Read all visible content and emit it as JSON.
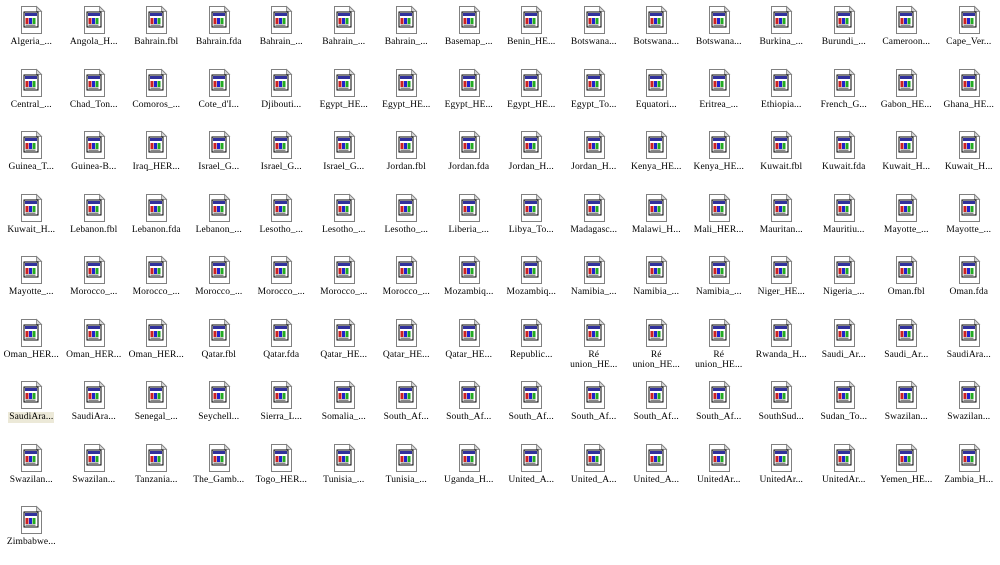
{
  "window": {
    "view_mode": "icons",
    "background_color": "#ffffff",
    "selection_highlight_color": "#ece9d8",
    "label_text_color": "#000000",
    "columns": 16,
    "rows": 9,
    "total_items": 129
  },
  "icon": {
    "semantic_name": "html-document-icon",
    "page_color": "#ffffff",
    "border_color": "#808080",
    "titlebar_color": "#31319c",
    "fold_color": "#c0c0c0",
    "content_colors": [
      "#cc2222",
      "#2222cc",
      "#22aa22",
      "#dd8800"
    ]
  },
  "files": [
    {
      "label": "Algeria_...",
      "selected": false
    },
    {
      "label": "Angola_H...",
      "selected": false
    },
    {
      "label": "Bahrain.fbl",
      "selected": false
    },
    {
      "label": "Bahrain.fda",
      "selected": false
    },
    {
      "label": "Bahrain_...",
      "selected": false
    },
    {
      "label": "Bahrain_...",
      "selected": false
    },
    {
      "label": "Bahrain_...",
      "selected": false
    },
    {
      "label": "Basemap_...",
      "selected": false
    },
    {
      "label": "Benin_HE...",
      "selected": false
    },
    {
      "label": "Botswana...",
      "selected": false
    },
    {
      "label": "Botswana...",
      "selected": false
    },
    {
      "label": "Botswana...",
      "selected": false
    },
    {
      "label": "Burkina_...",
      "selected": false
    },
    {
      "label": "Burundi_...",
      "selected": false
    },
    {
      "label": "Cameroon...",
      "selected": false
    },
    {
      "label": "Cape_Ver...",
      "selected": false
    },
    {
      "label": "Central_...",
      "selected": false
    },
    {
      "label": "Chad_Ton...",
      "selected": false
    },
    {
      "label": "Comoros_...",
      "selected": false
    },
    {
      "label": "Cote_d'I...",
      "selected": false
    },
    {
      "label": "Djibouti...",
      "selected": false
    },
    {
      "label": "Egypt_HE...",
      "selected": false
    },
    {
      "label": "Egypt_HE...",
      "selected": false
    },
    {
      "label": "Egypt_HE...",
      "selected": false
    },
    {
      "label": "Egypt_HE...",
      "selected": false
    },
    {
      "label": "Egypt_To...",
      "selected": false
    },
    {
      "label": "Equatori...",
      "selected": false
    },
    {
      "label": "Eritrea_...",
      "selected": false
    },
    {
      "label": "Ethiopia...",
      "selected": false
    },
    {
      "label": "French_G...",
      "selected": false
    },
    {
      "label": "Gabon_HE...",
      "selected": false
    },
    {
      "label": "Ghana_HE...",
      "selected": false
    },
    {
      "label": "Guinea_T...",
      "selected": false
    },
    {
      "label": "Guinea-B...",
      "selected": false
    },
    {
      "label": "Iraq_HER...",
      "selected": false
    },
    {
      "label": "Israel_G...",
      "selected": false
    },
    {
      "label": "Israel_G...",
      "selected": false
    },
    {
      "label": "Israel_G...",
      "selected": false
    },
    {
      "label": "Jordan.fbl",
      "selected": false
    },
    {
      "label": "Jordan.fda",
      "selected": false
    },
    {
      "label": "Jordan_H...",
      "selected": false
    },
    {
      "label": "Jordan_H...",
      "selected": false
    },
    {
      "label": "Kenya_HE...",
      "selected": false
    },
    {
      "label": "Kenya_HE...",
      "selected": false
    },
    {
      "label": "Kuwait.fbl",
      "selected": false
    },
    {
      "label": "Kuwait.fda",
      "selected": false
    },
    {
      "label": "Kuwait_H...",
      "selected": false
    },
    {
      "label": "Kuwait_H...",
      "selected": false
    },
    {
      "label": "Kuwait_H...",
      "selected": false
    },
    {
      "label": "Lebanon.fbl",
      "selected": false
    },
    {
      "label": "Lebanon.fda",
      "selected": false
    },
    {
      "label": "Lebanon_...",
      "selected": false
    },
    {
      "label": "Lesotho_...",
      "selected": false
    },
    {
      "label": "Lesotho_...",
      "selected": false
    },
    {
      "label": "Lesotho_...",
      "selected": false
    },
    {
      "label": "Liberia_...",
      "selected": false
    },
    {
      "label": "Libya_To...",
      "selected": false
    },
    {
      "label": "Madagasc...",
      "selected": false
    },
    {
      "label": "Malawi_H...",
      "selected": false
    },
    {
      "label": "Mali_HER...",
      "selected": false
    },
    {
      "label": "Mauritan...",
      "selected": false
    },
    {
      "label": "Mauritiu...",
      "selected": false
    },
    {
      "label": "Mayotte_...",
      "selected": false
    },
    {
      "label": "Mayotte_...",
      "selected": false
    },
    {
      "label": "Mayotte_...",
      "selected": false
    },
    {
      "label": "Morocco_...",
      "selected": false
    },
    {
      "label": "Morocco_...",
      "selected": false
    },
    {
      "label": "Morocco_...",
      "selected": false
    },
    {
      "label": "Morocco_...",
      "selected": false
    },
    {
      "label": "Morocco_...",
      "selected": false
    },
    {
      "label": "Morocco_...",
      "selected": false
    },
    {
      "label": "Mozambiq...",
      "selected": false
    },
    {
      "label": "Mozambiq...",
      "selected": false
    },
    {
      "label": "Namibia_...",
      "selected": false
    },
    {
      "label": "Namibia_...",
      "selected": false
    },
    {
      "label": "Namibia_...",
      "selected": false
    },
    {
      "label": "Niger_HE...",
      "selected": false
    },
    {
      "label": "Nigeria_...",
      "selected": false
    },
    {
      "label": "Oman.fbl",
      "selected": false
    },
    {
      "label": "Oman.fda",
      "selected": false
    },
    {
      "label": "Oman_HER...",
      "selected": false
    },
    {
      "label": "Oman_HER...",
      "selected": false
    },
    {
      "label": "Oman_HER...",
      "selected": false
    },
    {
      "label": "Qatar.fbl",
      "selected": false
    },
    {
      "label": "Qatar.fda",
      "selected": false
    },
    {
      "label": "Qatar_HE...",
      "selected": false
    },
    {
      "label": "Qatar_HE...",
      "selected": false
    },
    {
      "label": "Qatar_HE...",
      "selected": false
    },
    {
      "label": "Republic...",
      "selected": false
    },
    {
      "label": "Ré\nunion_HE...",
      "selected": false
    },
    {
      "label": "Ré\nunion_HE...",
      "selected": false
    },
    {
      "label": "Ré\nunion_HE...",
      "selected": false
    },
    {
      "label": "Rwanda_H...",
      "selected": false
    },
    {
      "label": "Saudi_Ar...",
      "selected": false
    },
    {
      "label": "Saudi_Ar...",
      "selected": false
    },
    {
      "label": "SaudiAra...",
      "selected": false
    },
    {
      "label": "SaudiAra...",
      "selected": true
    },
    {
      "label": "SaudiAra...",
      "selected": false
    },
    {
      "label": "Senegal_...",
      "selected": false
    },
    {
      "label": "Seychell...",
      "selected": false
    },
    {
      "label": "Sierra_L...",
      "selected": false
    },
    {
      "label": "Somalia_...",
      "selected": false
    },
    {
      "label": "South_Af...",
      "selected": false
    },
    {
      "label": "South_Af...",
      "selected": false
    },
    {
      "label": "South_Af...",
      "selected": false
    },
    {
      "label": "South_Af...",
      "selected": false
    },
    {
      "label": "South_Af...",
      "selected": false
    },
    {
      "label": "South_Af...",
      "selected": false
    },
    {
      "label": "SouthSud...",
      "selected": false
    },
    {
      "label": "Sudan_To...",
      "selected": false
    },
    {
      "label": "Swazilan...",
      "selected": false
    },
    {
      "label": "Swazilan...",
      "selected": false
    },
    {
      "label": "Swazilan...",
      "selected": false
    },
    {
      "label": "Swazilan...",
      "selected": false
    },
    {
      "label": "Tanzania...",
      "selected": false
    },
    {
      "label": "The_Gamb...",
      "selected": false
    },
    {
      "label": "Togo_HER...",
      "selected": false
    },
    {
      "label": "Tunisia_...",
      "selected": false
    },
    {
      "label": "Tunisia_...",
      "selected": false
    },
    {
      "label": "Uganda_H...",
      "selected": false
    },
    {
      "label": "United_A...",
      "selected": false
    },
    {
      "label": "United_A...",
      "selected": false
    },
    {
      "label": "United_A...",
      "selected": false
    },
    {
      "label": "UnitedAr...",
      "selected": false
    },
    {
      "label": "UnitedAr...",
      "selected": false
    },
    {
      "label": "UnitedAr...",
      "selected": false
    },
    {
      "label": "Yemen_HE...",
      "selected": false
    },
    {
      "label": "Zambia_H...",
      "selected": false
    },
    {
      "label": "Zimbabwe...",
      "selected": false
    }
  ]
}
